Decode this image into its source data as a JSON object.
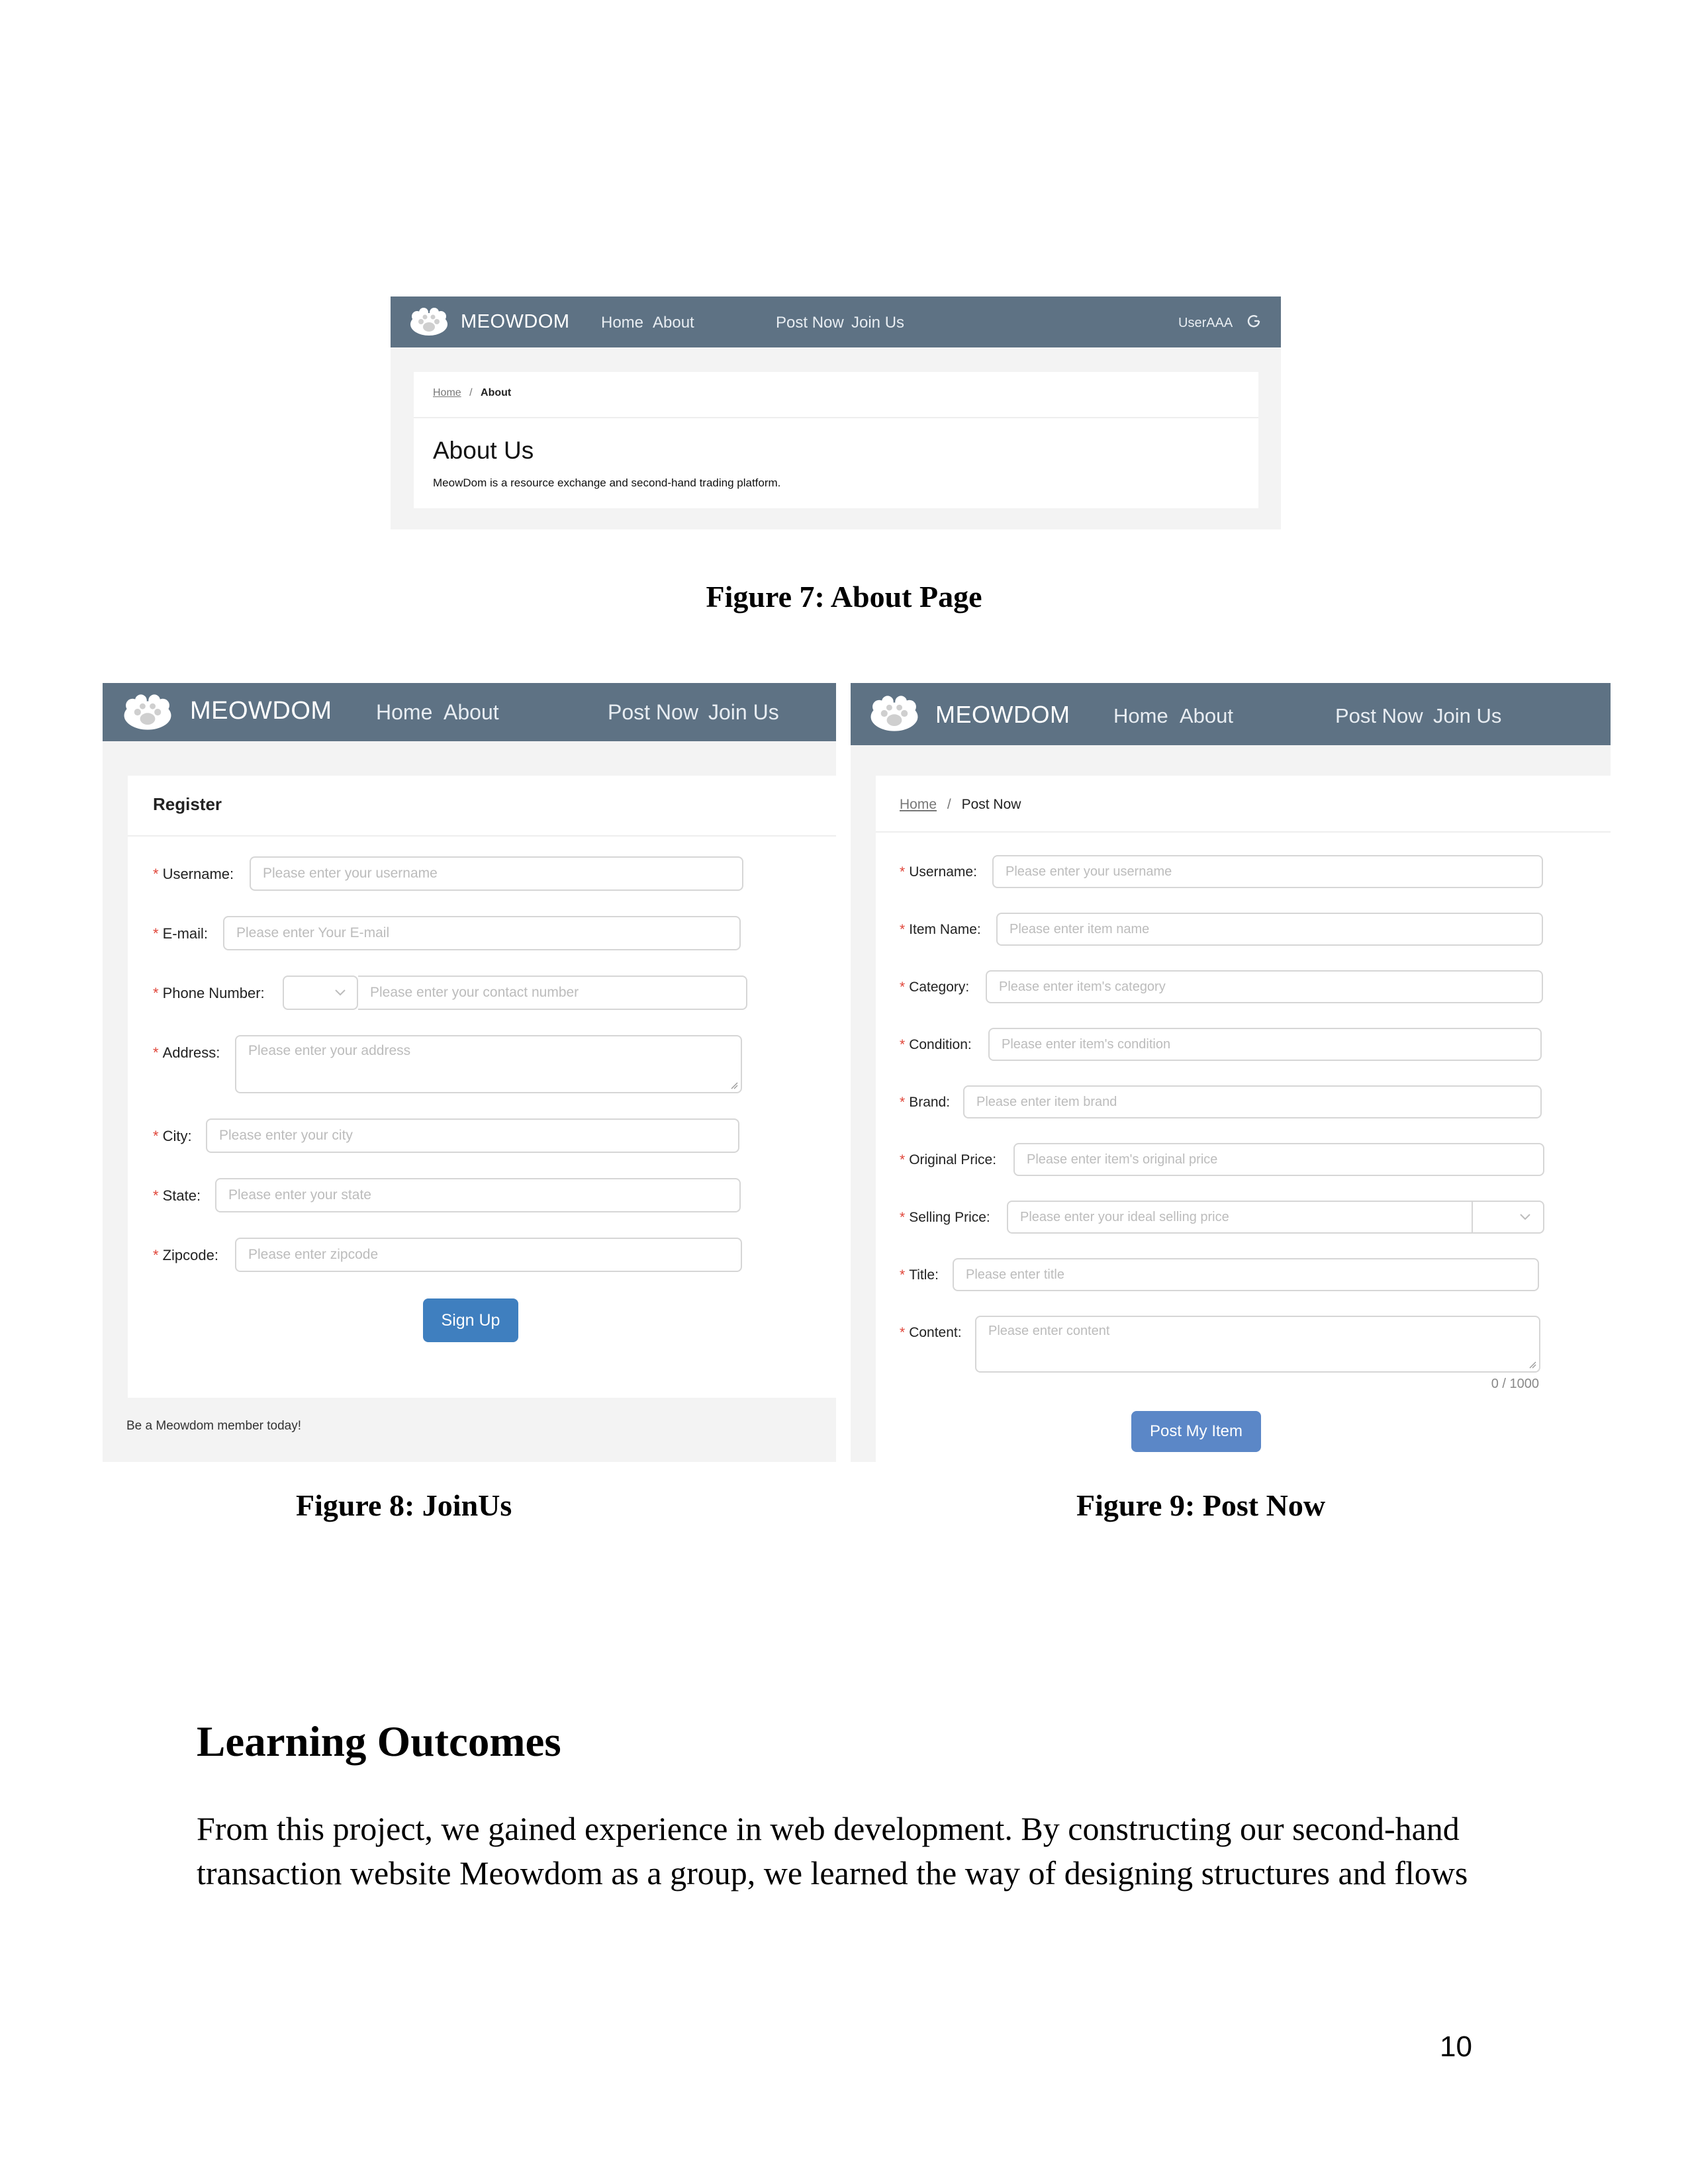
{
  "brand": "MEOWDOM",
  "nav": {
    "home": "Home",
    "about": "About",
    "post_now": "Post Now",
    "join_us": "Join Us",
    "user": "UserAAA"
  },
  "about_page": {
    "breadcrumb_home": "Home",
    "breadcrumb_sep": "/",
    "breadcrumb_current": "About",
    "heading": "About Us",
    "description": "MeowDom is a resource exchange and second-hand trading platform."
  },
  "captions": {
    "fig7": "Figure 7: About Page",
    "fig8": "Figure 8: JoinUs",
    "fig9": "Figure 9: Post Now"
  },
  "register": {
    "title": "Register",
    "fields": [
      {
        "label": "Username",
        "placeholder": "Please enter your username"
      },
      {
        "label": "E-mail",
        "placeholder": "Please enter Your E-mail"
      },
      {
        "label": "Phone Number",
        "placeholder": "Please enter your contact number"
      },
      {
        "label": "Address",
        "placeholder": "Please enter your address"
      },
      {
        "label": "City",
        "placeholder": "Please enter your city"
      },
      {
        "label": "State",
        "placeholder": "Please enter your state"
      },
      {
        "label": "Zipcode",
        "placeholder": "Please enter zipcode"
      }
    ],
    "submit": "Sign Up",
    "footer": "Be a Meowdom member today!"
  },
  "post": {
    "breadcrumb_home": "Home",
    "breadcrumb_sep": "/",
    "breadcrumb_current": "Post Now",
    "fields": [
      {
        "label": "Username",
        "placeholder": "Please enter your username"
      },
      {
        "label": "Item Name",
        "placeholder": "Please enter item name"
      },
      {
        "label": "Category",
        "placeholder": "Please enter item's category"
      },
      {
        "label": "Condition",
        "placeholder": "Please enter item's condition"
      },
      {
        "label": "Brand",
        "placeholder": "Please enter item brand"
      },
      {
        "label": "Original Price",
        "placeholder": "Please enter item's original price"
      },
      {
        "label": "Selling Price",
        "placeholder": "Please enter your ideal selling price"
      },
      {
        "label": "Title",
        "placeholder": "Please enter title"
      },
      {
        "label": "Content",
        "placeholder": "Please enter content"
      }
    ],
    "counter": "0 / 1000",
    "submit": "Post My Item"
  },
  "section": {
    "heading": "Learning Outcomes",
    "paragraph_line1": "From this project, we gained experience in web development. By constructing our second-hand",
    "paragraph_line2": "transaction website Meowdom as a group, we learned the way of designing structures and flows"
  },
  "page_number": "10",
  "colors": {
    "navbar": "#5e7284",
    "button": "#3f7fbf",
    "required_asterisk": "#e0463a"
  }
}
